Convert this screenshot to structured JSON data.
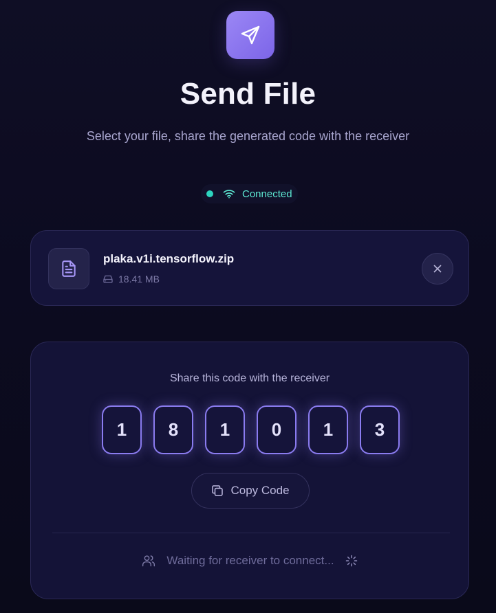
{
  "header": {
    "icon": "send-icon",
    "title": "Send File",
    "subtitle": "Select your file, share the generated code with the receiver"
  },
  "connection": {
    "status_text": "Connected",
    "icon": "wifi-icon",
    "color": "#2dd4bf"
  },
  "file": {
    "name": "plaka.v1i.tensorflow.zip",
    "size": "18.41 MB",
    "icon": "file-text-icon",
    "remove_icon": "close-icon"
  },
  "share": {
    "heading": "Share this code with the receiver",
    "digits": [
      "1",
      "8",
      "1",
      "0",
      "1",
      "3"
    ],
    "copy_label": "Copy Code",
    "copy_icon": "copy-icon",
    "waiting_text": "Waiting for receiver to connect...",
    "waiting_icon": "users-icon",
    "spinner_icon": "loader-icon"
  },
  "colors": {
    "accent": "#8b7cf0",
    "background": "#0f0e25",
    "card": "#15143a",
    "success": "#2dd4bf"
  }
}
